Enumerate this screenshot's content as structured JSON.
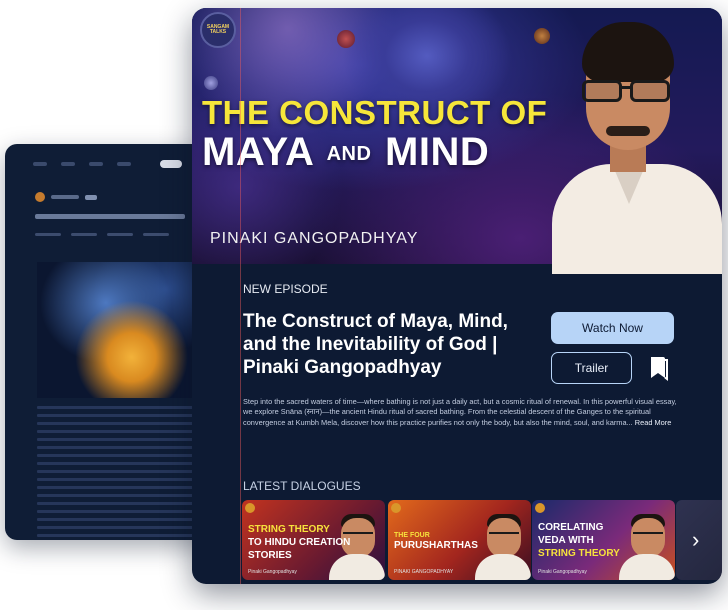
{
  "hero": {
    "logo": "SANGAM TALKS",
    "title_line1": "THE CONSTRUCT OF",
    "title_maya": "MAYA",
    "title_and": "AND",
    "title_mind": "MIND",
    "speaker": "PINAKI GANGOPADHYAY"
  },
  "episode": {
    "label": "NEW EPISODE",
    "title": "The Construct of Maya, Mind, and the Inevitability of God | Pinaki Gangopadhyay",
    "watch_label": "Watch Now",
    "trailer_label": "Trailer",
    "description": "Step into the sacred waters of time—where bathing is not just a daily act, but a cosmic ritual of renewal. In this powerful visual essay, we explore Snāna (स्नान)—the ancient Hindu ritual of sacred bathing. From the celestial descent of the Ganges to the spiritual convergence at Kumbh Mela, discover how this practice purifies not only the body, but also the mind, soul, and karma...",
    "read_more": "Read More"
  },
  "latest": {
    "label": "LATEST DIALOGUES",
    "items": [
      {
        "line1": "STRING THEORY",
        "line2": "TO HINDU CREATION",
        "line3": "STORIES",
        "speaker": "Pinaki Gangopadhyay"
      },
      {
        "line1": "THE FOUR",
        "line2": "PURUSHARTHAS",
        "speaker": "PINAKI GANGOPADHYAY"
      },
      {
        "line1": "CORELATING",
        "line2": "VEDA WITH",
        "line3": "STRING THEORY",
        "speaker": "Pinaki Gangopadhyay"
      }
    ]
  },
  "colors": {
    "page_bg": "#ffffff",
    "device_bg": "#0d1a33",
    "accent_button": "#b7d4f7",
    "title_yellow": "#f6e63a"
  },
  "icons": [
    "bookmark-icon",
    "chevron-right-icon"
  ]
}
